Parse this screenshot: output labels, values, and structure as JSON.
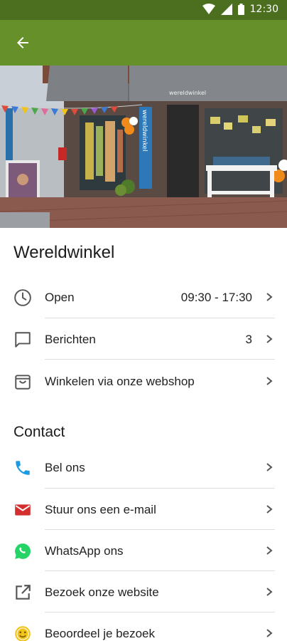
{
  "status_bar": {
    "time": "12:30"
  },
  "app_bar": {
    "back_icon": "arrow-back-icon",
    "color": "#66902a"
  },
  "hero": {
    "shop_sign": "wereldwinkel",
    "awning_sign": "wereldwinkel"
  },
  "shop": {
    "title": "Wereldwinkel"
  },
  "info_rows": [
    {
      "label": "Open",
      "value": "09:30 - 17:30",
      "icon": "clock-icon"
    },
    {
      "label": "Berichten",
      "value": "3",
      "icon": "message-icon"
    },
    {
      "label": "Winkelen via onze webshop",
      "icon": "shopping-bag-icon"
    }
  ],
  "contact": {
    "heading": "Contact",
    "rows": [
      {
        "label": "Bel ons",
        "icon": "phone-icon",
        "color": "#1e9be0"
      },
      {
        "label": "Stuur ons een e-mail",
        "icon": "mail-icon",
        "color": "#d32f2f"
      },
      {
        "label": "WhatsApp ons",
        "icon": "whatsapp-icon",
        "color": "#25d366"
      },
      {
        "label": "Bezoek onze website",
        "icon": "external-link-icon",
        "color": "#555555"
      },
      {
        "label": "Beoordeel je bezoek",
        "icon": "smiley-icon",
        "color": "#f2c31b"
      }
    ]
  }
}
